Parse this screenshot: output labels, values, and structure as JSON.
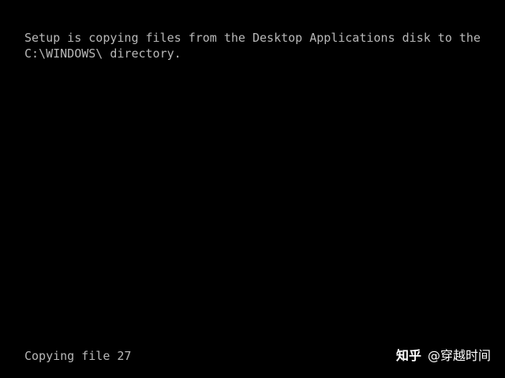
{
  "setup_message": {
    "line1": "Setup is copying files from the Desktop Applications disk to the",
    "line2": "C:\\WINDOWS\\ directory."
  },
  "status": {
    "text": "Copying file 27"
  },
  "watermark": {
    "brand": "知乎",
    "handle": "@穿越时间"
  },
  "colors": {
    "background": "#000000",
    "console_text": "#b8b8b8",
    "watermark_text": "#ffffff"
  }
}
